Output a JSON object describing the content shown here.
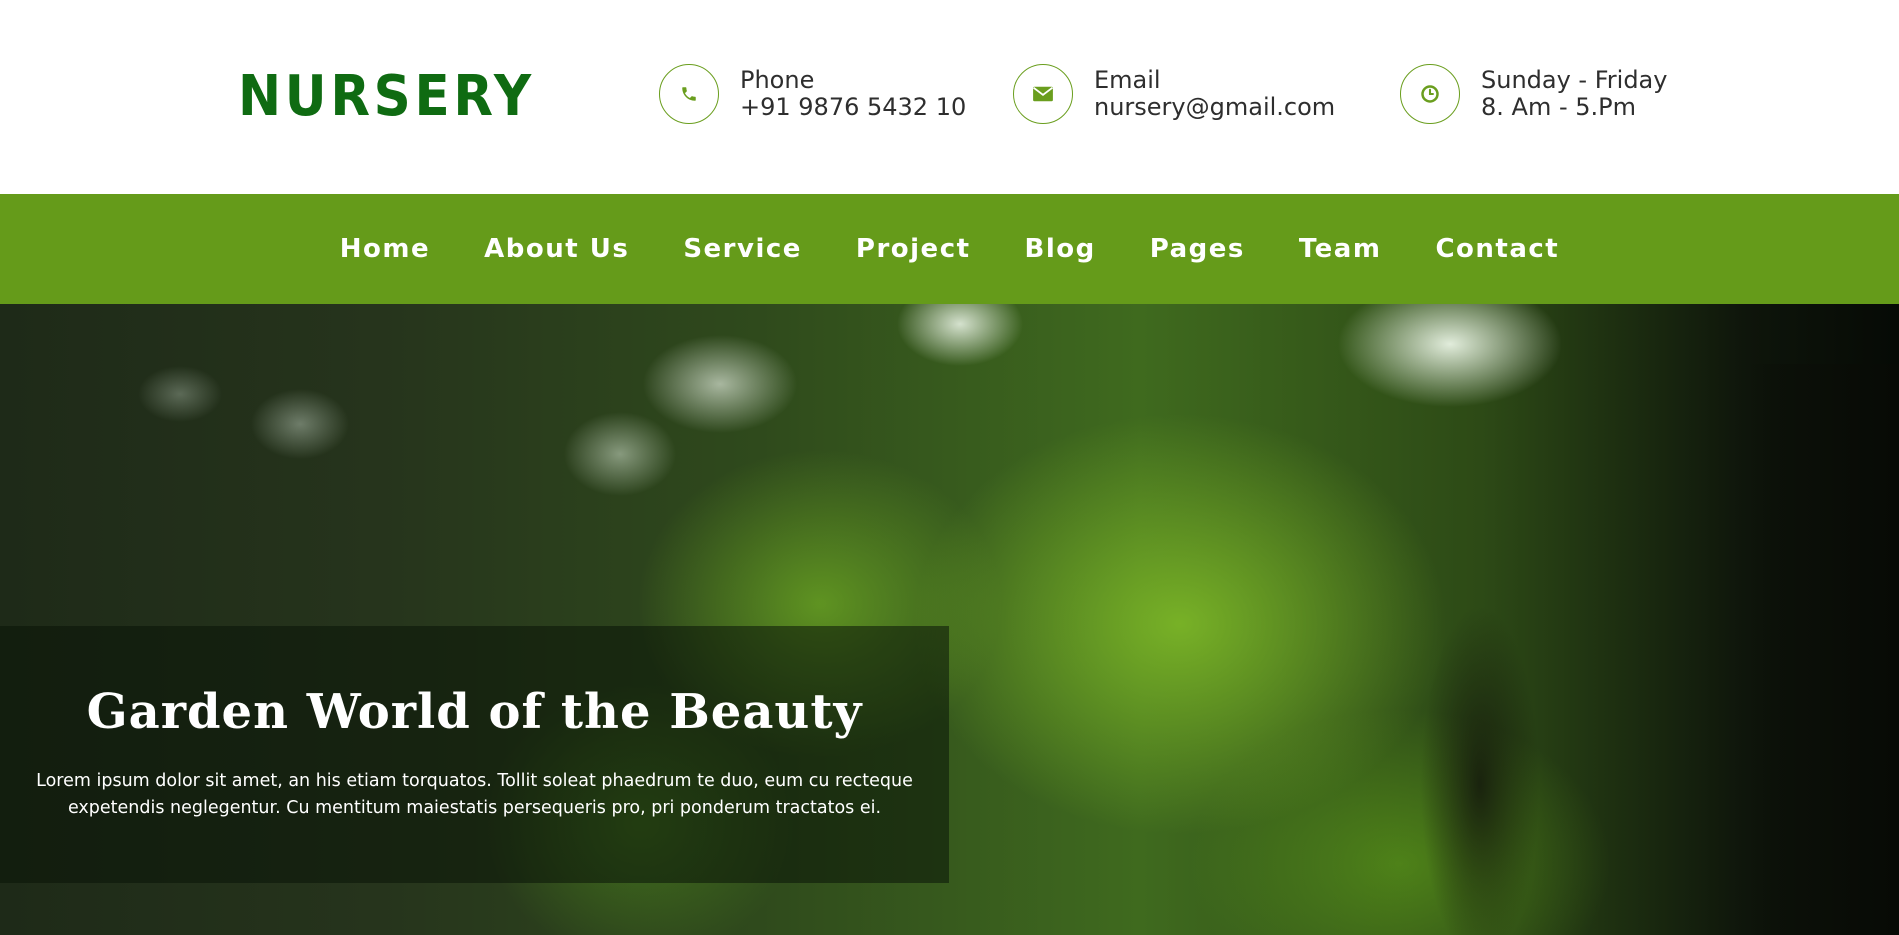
{
  "brand": {
    "logo": "NURSERY"
  },
  "contact": {
    "phone": {
      "label": "Phone",
      "value": "+91 9876 5432 10",
      "icon": "phone-icon"
    },
    "email": {
      "label": "Email",
      "value": "nursery@gmail.com",
      "icon": "envelope-icon"
    },
    "hours": {
      "label": "Sunday - Friday",
      "value": "8. Am - 5.Pm",
      "icon": "clock-icon"
    }
  },
  "nav": {
    "items": [
      {
        "label": "Home"
      },
      {
        "label": "About Us"
      },
      {
        "label": "Service"
      },
      {
        "label": "Project"
      },
      {
        "label": "Blog"
      },
      {
        "label": "Pages"
      },
      {
        "label": "Team"
      },
      {
        "label": "Contact"
      }
    ]
  },
  "hero": {
    "title": "Garden World of the Beauty",
    "text": "Lorem ipsum dolor sit amet, an his etiam torquatos. Tollit soleat phaedrum te duo, eum cu recteque expetendis neglegentur. Cu mentitum maiestatis persequeris pro, pri ponderum tractatos ei."
  },
  "colors": {
    "brand_green": "#0f6b12",
    "nav_green": "#659b1a",
    "icon_green": "#6a9e1e"
  }
}
